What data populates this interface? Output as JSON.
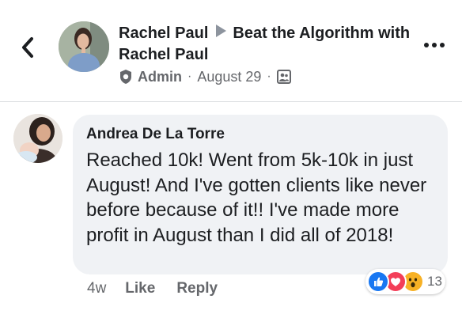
{
  "header": {
    "back_icon": "chevron-left-icon",
    "author": "Rachel Paul",
    "group": "Beat the Algorithm with Rachel Paul",
    "role": "Admin",
    "date": "August 29",
    "audience_icon": "group-icon",
    "more_icon": "more-horizontal-icon"
  },
  "comment": {
    "author": "Andrea De La Torre",
    "text": "Reached 10k! Went from 5k-10k in just August! And I've gotten clients like never before because of it!! I've made more profit in August than I did all of 2018!",
    "time": "4w",
    "like_label": "Like",
    "reply_label": "Reply",
    "reaction_count": "13",
    "reaction_icons": [
      "like-icon",
      "love-icon",
      "wow-icon"
    ]
  },
  "colors": {
    "bubble": "#f0f2f5",
    "secondary_text": "#65676b",
    "like_blue": "#1877f2",
    "love_red": "#f33e58",
    "wow_yellow": "#f7b125"
  }
}
